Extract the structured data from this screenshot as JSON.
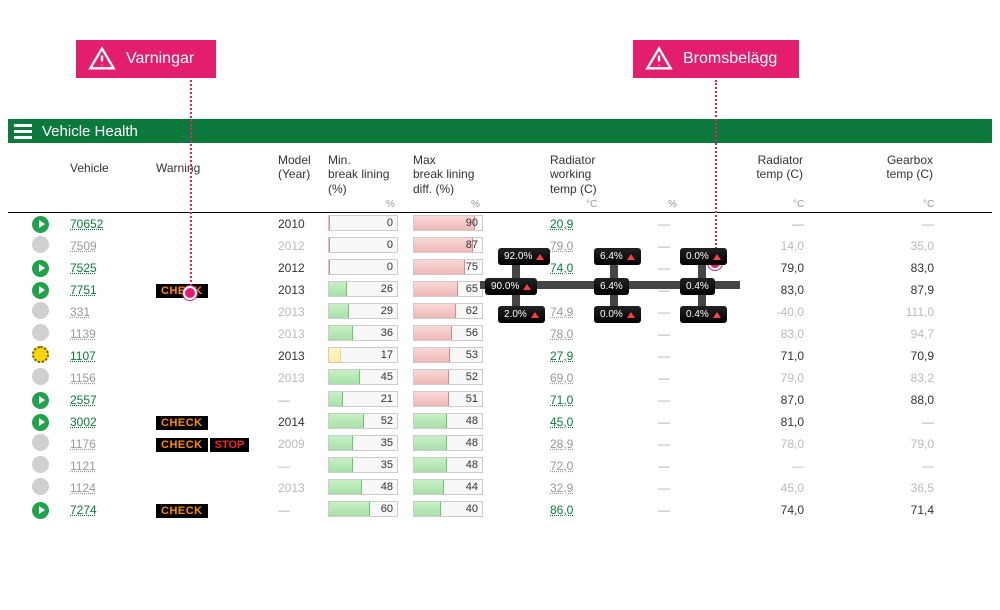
{
  "callouts": {
    "warnings": "Varningar",
    "brakes": "Bromsbelägg"
  },
  "header": {
    "title": "Vehicle Health"
  },
  "columns": {
    "vehicle": "Vehicle",
    "warning": "Warning",
    "model": "Model\n(Year)",
    "min": "Min.\nbreak lining\n(%)",
    "max": "Max\nbreak lining\ndiff. (%)",
    "rad_work": "Radiator\nworking\ntemp (C)",
    "rad_temp": "Radiator\ntemp (C)",
    "gearbox": "Gearbox\ntemp (C)"
  },
  "units": {
    "pct": "%",
    "c": "°C"
  },
  "tooltip": {
    "w1": "92.0%",
    "w2": "0.0%",
    "w3": "6.4%",
    "w4": "90.0%",
    "w5": "6.4%",
    "w6": "0.4%",
    "w7": "2.0%",
    "w8": "0.0%",
    "w9": "0.4%"
  },
  "rows": [
    {
      "status": "green",
      "vehicle": "70652",
      "warning": "",
      "model": "2010",
      "min": 0,
      "min_color": "red",
      "max": 90,
      "max_color": "red",
      "rad_work": "20,9",
      "rad_work_link": true,
      "rad_temp": "—",
      "gearbox": "—"
    },
    {
      "status": "grey",
      "vehicle": "7509",
      "warning": "",
      "model": "2012",
      "min": 0,
      "min_color": "red",
      "max": 87,
      "max_color": "red",
      "rad_work": "79,0",
      "rad_work_link": false,
      "rad_temp": "14,0",
      "gearbox": "35,0",
      "faded": true
    },
    {
      "status": "green",
      "vehicle": "7525",
      "warning": "",
      "model": "2012",
      "min": 0,
      "min_color": "red",
      "max": 75,
      "max_color": "red",
      "rad_work": "74,0",
      "rad_work_link": true,
      "rad_temp": "79,0",
      "gearbox": "83,0"
    },
    {
      "status": "green",
      "vehicle": "7751",
      "warning": "CHECK",
      "model": "2013",
      "min": 26,
      "min_color": "green",
      "max": 65,
      "max_color": "red",
      "rad_work": "",
      "rad_work_link": true,
      "rad_temp": "83,0",
      "gearbox": "87,9"
    },
    {
      "status": "grey",
      "vehicle": "331",
      "warning": "",
      "model": "2013",
      "min": 29,
      "min_color": "green",
      "max": 62,
      "max_color": "red",
      "rad_work": "74,9",
      "rad_work_link": false,
      "rad_temp": "-40,0",
      "gearbox": "111,0",
      "faded": true
    },
    {
      "status": "grey",
      "vehicle": "1139",
      "warning": "",
      "model": "2013",
      "min": 36,
      "min_color": "green",
      "max": 56,
      "max_color": "red",
      "rad_work": "78,0",
      "rad_work_link": false,
      "rad_temp": "83,0",
      "gearbox": "94,7",
      "faded": true
    },
    {
      "status": "yellow",
      "vehicle": "1107",
      "warning": "",
      "model": "2013",
      "min": 17,
      "min_color": "yellow",
      "max": 53,
      "max_color": "red",
      "rad_work": "27,9",
      "rad_work_link": true,
      "rad_temp": "71,0",
      "gearbox": "70,9"
    },
    {
      "status": "grey",
      "vehicle": "1156",
      "warning": "",
      "model": "2013",
      "min": 45,
      "min_color": "green",
      "max": 52,
      "max_color": "red",
      "rad_work": "69,0",
      "rad_work_link": false,
      "rad_temp": "79,0",
      "gearbox": "83,2",
      "faded": true
    },
    {
      "status": "green",
      "vehicle": "2557",
      "warning": "",
      "model": "—",
      "min": 21,
      "min_color": "green",
      "max": 51,
      "max_color": "red",
      "rad_work": "71,0",
      "rad_work_link": true,
      "rad_temp": "87,0",
      "gearbox": "88,0"
    },
    {
      "status": "green",
      "vehicle": "3002",
      "warning": "CHECK",
      "model": "2014",
      "min": 52,
      "min_color": "green",
      "max": 48,
      "max_color": "green",
      "rad_work": "45,0",
      "rad_work_link": true,
      "rad_temp": "81,0",
      "gearbox": "—"
    },
    {
      "status": "grey",
      "vehicle": "1176",
      "warning": "CHECK STOP",
      "model": "2009",
      "min": 35,
      "min_color": "green",
      "max": 48,
      "max_color": "green",
      "rad_work": "28,9",
      "rad_work_link": false,
      "rad_temp": "78,0",
      "gearbox": "79,0",
      "faded": true
    },
    {
      "status": "grey",
      "vehicle": "1121",
      "warning": "",
      "model": "—",
      "min": 35,
      "min_color": "green",
      "max": 48,
      "max_color": "green",
      "rad_work": "72,0",
      "rad_work_link": false,
      "rad_temp": "—",
      "gearbox": "—",
      "faded": true
    },
    {
      "status": "grey",
      "vehicle": "1124",
      "warning": "",
      "model": "2013",
      "min": 48,
      "min_color": "green",
      "max": 44,
      "max_color": "green",
      "rad_work": "32,9",
      "rad_work_link": false,
      "rad_temp": "45,0",
      "gearbox": "36,5",
      "faded": true
    },
    {
      "status": "green",
      "vehicle": "7274",
      "warning": "CHECK",
      "model": "—",
      "min": 60,
      "min_color": "green",
      "max": 40,
      "max_color": "green",
      "rad_work": "86,0",
      "rad_work_link": true,
      "rad_temp": "74,0",
      "gearbox": "71,4"
    }
  ]
}
